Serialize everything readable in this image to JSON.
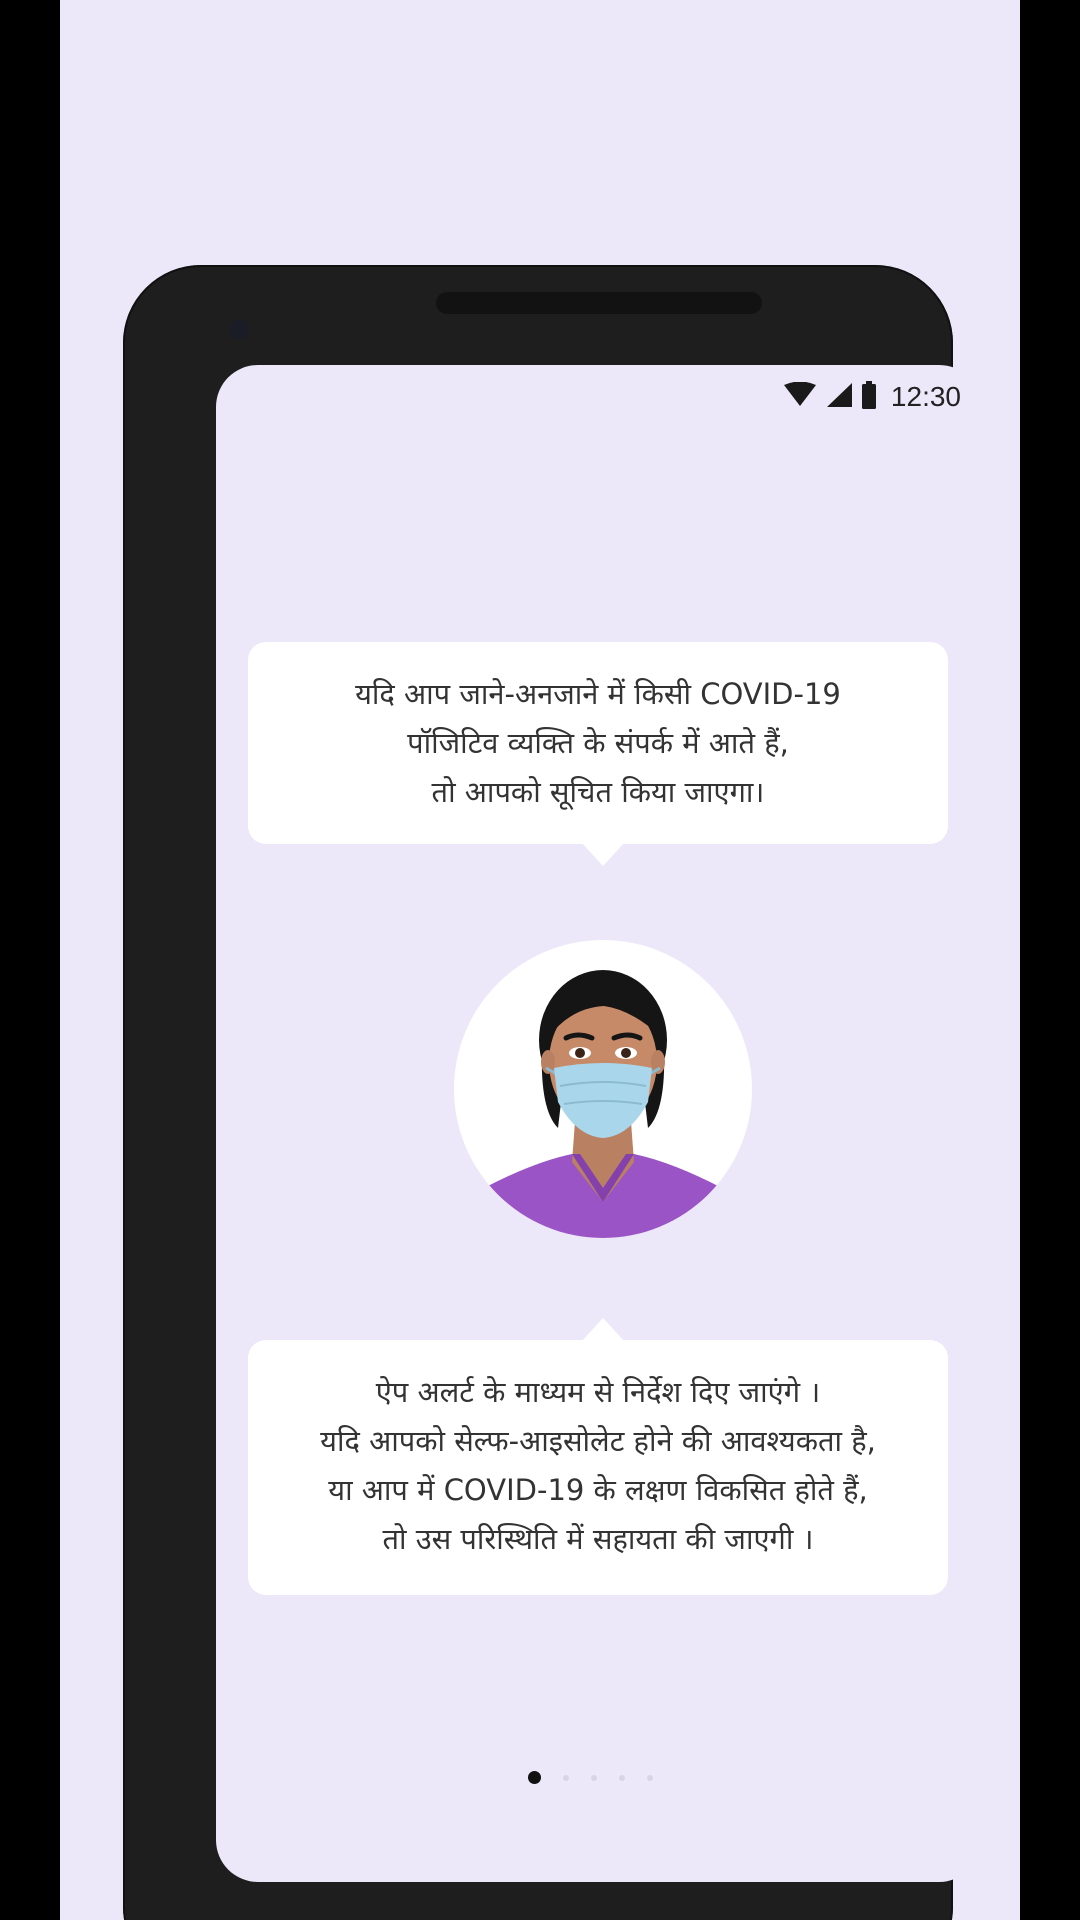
{
  "status_bar": {
    "time": "12:30",
    "icons": [
      "wifi-icon",
      "signal-icon",
      "battery-icon"
    ]
  },
  "top_bubble": {
    "lines": [
      "यदि आप जाने-अनजाने में किसी COVID-19",
      "पॉजिटिव व्यक्ति के संपर्क में आते हैं,",
      "तो आपको सूचित किया जाएगा।"
    ]
  },
  "bottom_bubble": {
    "lines": [
      "ऐप अलर्ट के माध्यम से निर्देश दिए जाएंगे ।",
      "यदि आपको सेल्फ-आइसोलेट होने की आवश्यकता है,",
      "या आप में COVID-19 के लक्षण विकसित होते हैं,",
      "तो उस परिस्थिति में सहायता की जाएगी ।"
    ]
  },
  "illustration": {
    "icon": "masked-person-icon"
  },
  "pagination": {
    "total": 5,
    "active_index": 0
  },
  "colors": {
    "background": "#ece8f9",
    "phone_body": "#1e1e1f",
    "mask": "#a9d6ea",
    "shirt": "#9b54c6"
  }
}
